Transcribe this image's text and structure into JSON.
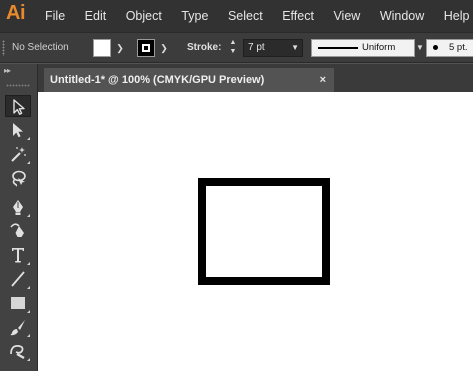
{
  "app": {
    "logo": "Ai",
    "menu": [
      "File",
      "Edit",
      "Object",
      "Type",
      "Select",
      "Effect",
      "View",
      "Window",
      "Help"
    ]
  },
  "control_bar": {
    "selection_status": "No Selection",
    "fill_color": "#ffffff",
    "stroke_color": "#000000",
    "stroke_label": "Stroke:",
    "stroke_weight": "7 pt",
    "variable_width_profile": "Uniform",
    "brush_definition": "5 pt."
  },
  "document": {
    "tab_title": "Untitled-1* @ 100% (CMYK/GPU Preview)",
    "close_glyph": "×"
  },
  "canvas": {
    "background_color": "#ffffff",
    "shape": {
      "type": "rectangle",
      "fill": "#ffffff",
      "stroke": "#000000",
      "stroke_weight": "7 pt"
    }
  },
  "tools": [
    {
      "name": "selection-tool",
      "icon": "selection-arrow-icon",
      "active": true
    },
    {
      "name": "direct-selection-tool",
      "icon": "direct-selection-arrow-icon",
      "active": false
    },
    {
      "name": "magic-wand-tool",
      "icon": "magic-wand-icon",
      "active": false
    },
    {
      "name": "lasso-tool",
      "icon": "lasso-icon",
      "active": false
    },
    {
      "name": "pen-tool",
      "icon": "pen-icon",
      "active": false
    },
    {
      "name": "curvature-tool",
      "icon": "curvature-pen-icon",
      "active": false
    },
    {
      "name": "type-tool",
      "icon": "type-icon",
      "active": false
    },
    {
      "name": "line-segment-tool",
      "icon": "line-segment-icon",
      "active": false
    },
    {
      "name": "rectangle-tool",
      "icon": "rectangle-icon",
      "active": false
    },
    {
      "name": "paintbrush-tool",
      "icon": "paintbrush-icon",
      "active": false
    },
    {
      "name": "shaper-tool",
      "icon": "shaper-icon",
      "active": false
    }
  ]
}
